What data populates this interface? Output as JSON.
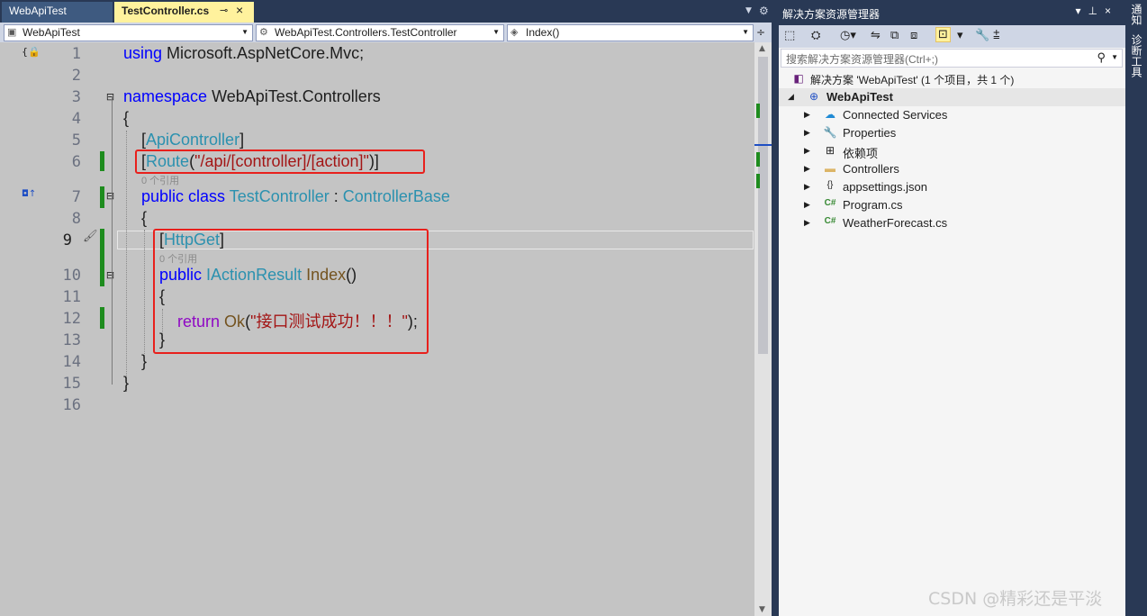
{
  "tabs": {
    "inactive": "WebApiTest",
    "active": "TestController.cs",
    "pin_icon": "pin-icon",
    "close_icon": "close-icon"
  },
  "navbar": {
    "project": "WebApiTest",
    "class": "WebApiTest.Controllers.TestController",
    "member": "Index()"
  },
  "editor": {
    "line_numbers": [
      "1",
      "2",
      "3",
      "4",
      "5",
      "6",
      "7",
      "8",
      "9",
      "10",
      "11",
      "12",
      "13",
      "14",
      "15",
      "16"
    ],
    "code": {
      "l1_kw": "using",
      "l1_rest": " Microsoft.AspNetCore.Mvc;",
      "l3_kw": "namespace",
      "l3_rest": " WebApiTest.Controllers",
      "l4": "{",
      "l5_open": "[",
      "l5_type": "ApiController",
      "l5_close": "]",
      "l6_open": "[",
      "l6_type": "Route",
      "l6_paren": "(",
      "l6_str": "\"/api/[controller]/[action]\"",
      "l6_close": ")]",
      "l7_kw": "public class",
      "l7_type": "TestController",
      "l7_colon": " : ",
      "l7_base": "ControllerBase",
      "l8": "{",
      "l9_open": "[",
      "l9_type": "HttpGet",
      "l9_close": "]",
      "l10_kw": "public",
      "l10_type": "IActionResult",
      "l10_meth": "Index",
      "l10_rest": "()",
      "l11": "{",
      "l12_kw": "return",
      "l12_meth": "Ok",
      "l12_paren": "(",
      "l12_str": "\"接口测试成功！！！\"",
      "l12_close": ");",
      "l13": "}",
      "l14": "}",
      "l15": "}"
    },
    "ref_hint_1": "0 个引用",
    "ref_hint_2": "0 个引用"
  },
  "solution_explorer": {
    "title": "解决方案资源管理器",
    "search_placeholder": "搜索解决方案资源管理器(Ctrl+;)",
    "solution_label": "解决方案 'WebApiTest' (1 个项目，共 1 个)",
    "project_label": "WebApiTest",
    "items": [
      {
        "label": "Connected Services",
        "icon": "connected-services-icon"
      },
      {
        "label": "Properties",
        "icon": "wrench-icon"
      },
      {
        "label": "依赖项",
        "icon": "dependencies-icon"
      },
      {
        "label": "Controllers",
        "icon": "folder-icon"
      },
      {
        "label": "appsettings.json",
        "icon": "json-file-icon"
      },
      {
        "label": "Program.cs",
        "icon": "csharp-file-icon"
      },
      {
        "label": "WeatherForecast.cs",
        "icon": "csharp-file-icon"
      }
    ]
  },
  "side_tabs": {
    "notifications": "通知",
    "diagnostics": "诊断工具"
  },
  "watermark": "CSDN @精彩还是平淡",
  "colors": {
    "keyword": "#0000ff",
    "type": "#2b91af",
    "string": "#a31515",
    "method": "#74531f",
    "control": "#8f08c4",
    "highlight_box": "#e8201c",
    "change_bar": "#1e8c1e"
  }
}
